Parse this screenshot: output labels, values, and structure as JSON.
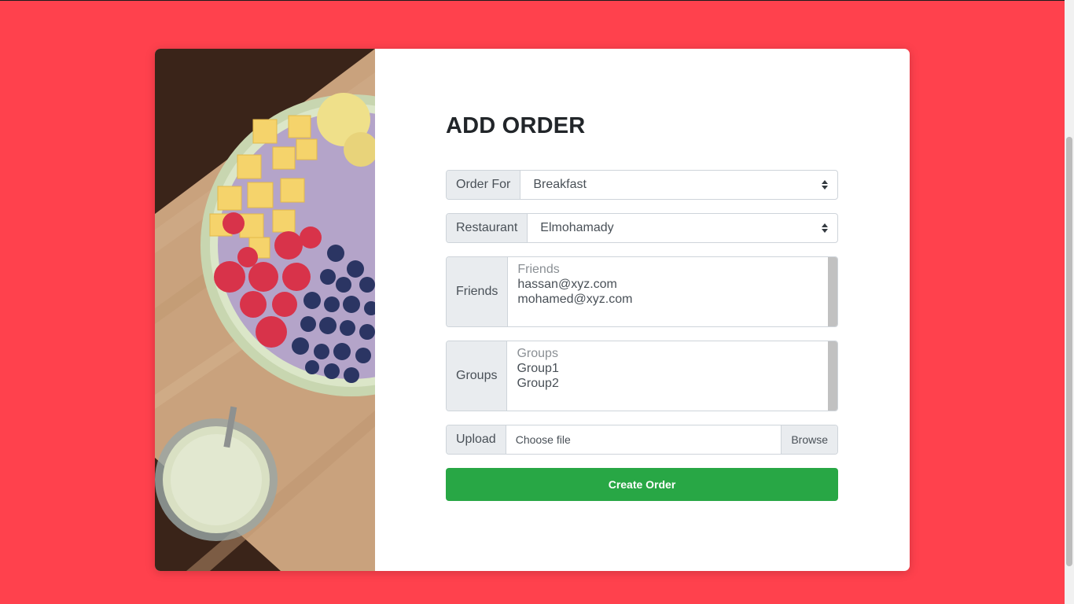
{
  "form": {
    "title": "ADD ORDER",
    "order_for": {
      "label": "Order For",
      "value": "Breakfast"
    },
    "restaurant": {
      "label": "Restaurant",
      "value": "Elmohamady"
    },
    "friends": {
      "label": "Friends",
      "placeholder": "Friends",
      "options": [
        "hassan@xyz.com",
        "mohamed@xyz.com"
      ]
    },
    "groups": {
      "label": "Groups",
      "placeholder": "Groups",
      "options": [
        "Group1",
        "Group2"
      ]
    },
    "upload": {
      "label": "Upload",
      "file_text": "Choose file",
      "browse_label": "Browse"
    },
    "submit_label": "Create Order"
  },
  "colors": {
    "page_background": "#ff414d",
    "submit_button": "#28a745",
    "addon_background": "#e9ecef"
  }
}
